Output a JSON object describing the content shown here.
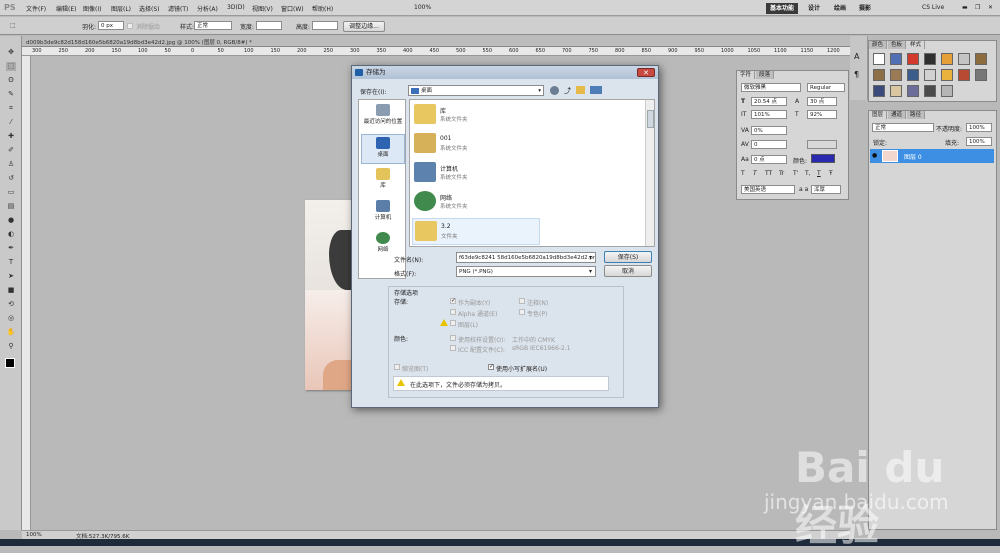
{
  "app": {
    "logo": "PS"
  },
  "menus": [
    "文件(F)",
    "编辑(E)",
    "图像(I)",
    "图层(L)",
    "选择(S)",
    "滤镜(T)",
    "分析(A)",
    "3D(D)",
    "视图(V)",
    "窗口(W)",
    "帮助(H)"
  ],
  "zoom": "100%",
  "workspace": [
    "基本功能",
    "设计",
    "绘画",
    "摄影"
  ],
  "cs_live": "CS Live",
  "options": {
    "feather_label": "羽化:",
    "feather_value": "0 px",
    "antialias": "消除锯齿",
    "style_label": "样式:",
    "style_value": "正常",
    "width_label": "宽度:",
    "height_label": "高度:",
    "refine": "调整边缘..."
  },
  "document_tab": "d009b3de9c82d158d160e5b6820a19d8bd3e42d2.jpg @ 100% (图层 0, RGB/8#) *",
  "ruler_ticks": [
    "300",
    "250",
    "200",
    "150",
    "100",
    "50",
    "0",
    "50",
    "100",
    "150",
    "200",
    "250",
    "300",
    "350",
    "400",
    "450",
    "500",
    "550",
    "600",
    "650",
    "700",
    "750",
    "800",
    "850",
    "900",
    "950",
    "1000",
    "1050",
    "1100",
    "1150",
    "1200"
  ],
  "status": {
    "zoom": "100%",
    "doc": "文档:527.3K/795.6K"
  },
  "dialog": {
    "title": "存储为",
    "save_in_label": "保存在(I):",
    "save_in_value": "桌面",
    "places": [
      "最近访问的位置",
      "桌面",
      "库",
      "计算机",
      "网络"
    ],
    "files": [
      {
        "name": "库",
        "type": "系统文件夹"
      },
      {
        "name": "001",
        "type": "系统文件夹"
      },
      {
        "name": "计算机",
        "type": "系统文件夹"
      },
      {
        "name": "网络",
        "type": "系统文件夹"
      },
      {
        "name": "3.2",
        "type": "文件夹"
      }
    ],
    "filename_label": "文件名(N):",
    "filename_value": "f63de9c8241 58d160e5b6820a19d8bd3e42d2.png",
    "format_label": "格式(F):",
    "format_value": "PNG (*.PNG)",
    "save_button": "保存(S)",
    "cancel_button": "取消",
    "save_options_title": "存储选项",
    "storage_label": "存储:",
    "as_copy": "作为副本(Y)",
    "notes": "注释(N)",
    "alpha": "Alpha 通道(E)",
    "spot": "专色(P)",
    "layers": "图层(L)",
    "color_label": "颜色:",
    "proof": "使用校样设置(O):",
    "proof_value": "工作中的 CMYK",
    "icc": "ICC 配置文件(C):",
    "icc_value": "sRGB IEC61966-2.1",
    "thumbnail": "缩览图(T)",
    "lowercase": "使用小写扩展名(U)",
    "warning": "在此选项下，文件必须存储为拷贝。"
  },
  "char_panel": {
    "tabs": [
      "字符",
      "段落"
    ],
    "font": "微软雅黑",
    "style": "Regular",
    "size": "20.54 点",
    "leading": "30 点",
    "vscale": "101%",
    "hscale": "92%",
    "tracking": "0%",
    "kerning": "0",
    "baseline": "0 点",
    "color_label": "颜色:",
    "color": "#2a2ab0",
    "typo_buttons": [
      "T",
      "T",
      "TT",
      "Tr",
      "T'",
      "T,",
      "T",
      "Ŧ"
    ],
    "language": "美国英语",
    "aa_label": "a a",
    "aa": "浑厚"
  },
  "style_panel": {
    "tabs": [
      "颜色",
      "色板",
      "样式"
    ]
  },
  "layers_panel": {
    "tabs": [
      "图层",
      "通道",
      "路径"
    ],
    "mode": "正常",
    "opacity_label": "不透明度:",
    "opacity": "100%",
    "lock_label": "锁定:",
    "fill_label": "填充:",
    "fill": "100%",
    "layer_name": "图层 0"
  },
  "watermark": {
    "main": "Bai du 经验",
    "sub": "jingyan.baidu.com"
  }
}
